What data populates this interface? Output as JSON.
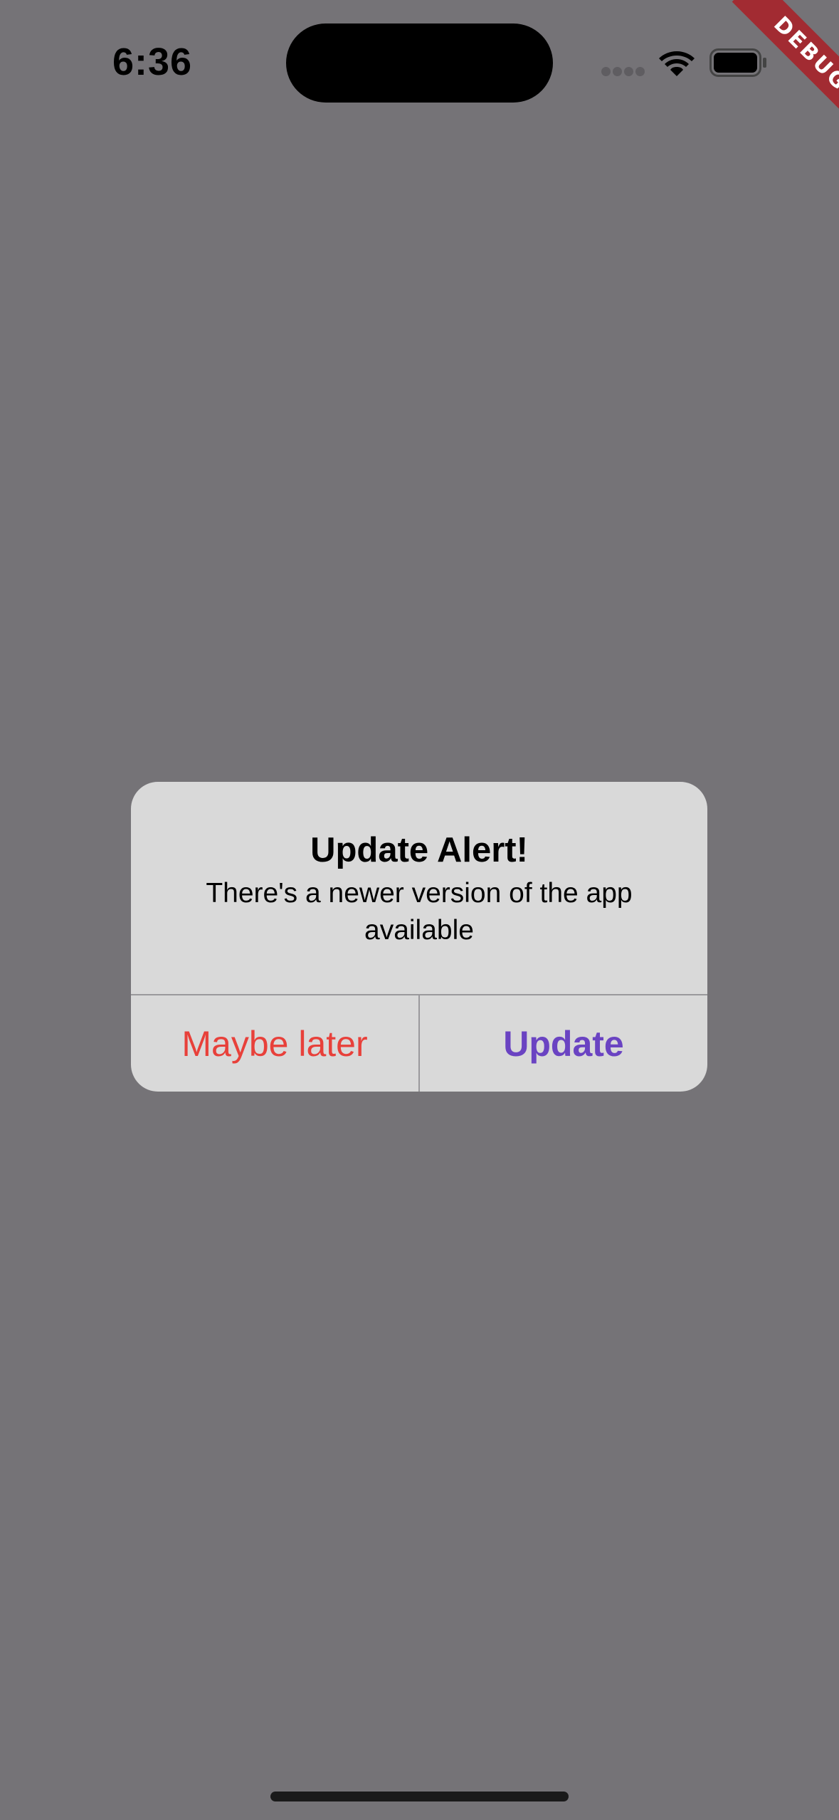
{
  "status_bar": {
    "time": "6:36",
    "icons": [
      "signal-dots-icon",
      "wifi-icon",
      "battery-icon"
    ]
  },
  "debug_banner": {
    "label": "DEBUG",
    "color": "#a22b32"
  },
  "alert": {
    "title": "Update Alert!",
    "message": "There's a newer version of the app available",
    "actions": {
      "maybe_later_label": "Maybe later",
      "update_label": "Update"
    }
  },
  "colors": {
    "backdrop": "#757377",
    "alert_background": "#d9d9d9",
    "maybe_later_text": "#e8403a",
    "update_text": "#6a43c2"
  }
}
